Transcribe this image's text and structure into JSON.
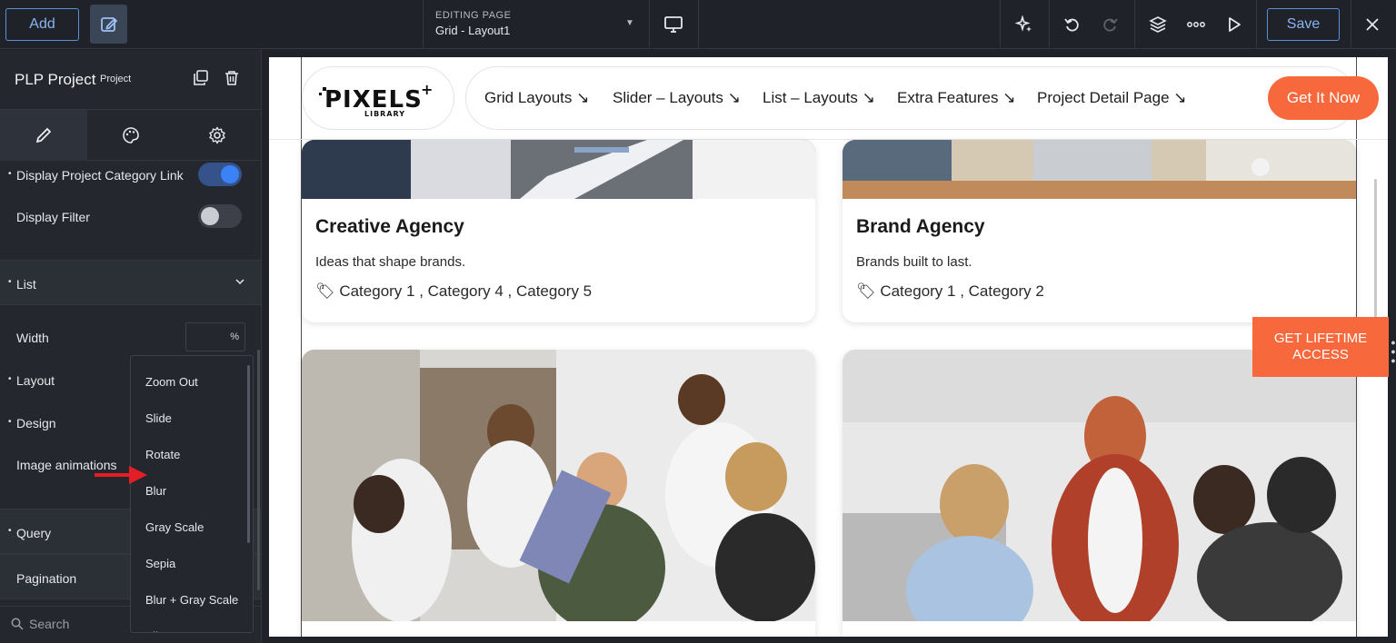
{
  "topbar": {
    "add_label": "Add",
    "editing_label": "EDITING PAGE",
    "editing_value": "Grid - Layout1",
    "save_label": "Save"
  },
  "panel": {
    "title": "PLP Project",
    "subtitle": "Project",
    "rows": {
      "display_category_link": "Display Project Category Link",
      "display_filter": "Display Filter",
      "width": "Width",
      "width_unit": "%",
      "layout": "Layout",
      "design": "Design",
      "image_animations": "Image animations"
    },
    "sections": {
      "list": "List",
      "query": "Query",
      "pagination": "Pagination"
    },
    "toggles": {
      "display_category_link": true,
      "display_filter": false
    },
    "search_placeholder": "Search"
  },
  "dropdown": {
    "options": [
      "Zoom Out",
      "Slide",
      "Rotate",
      "Blur",
      "Gray Scale",
      "Sepia",
      "Blur + Gray Scale",
      "Flip H..."
    ]
  },
  "site": {
    "logo_text": "PIXELS",
    "logo_sub": "LIBRARY",
    "nav": [
      "Grid Layouts ↘",
      "Slider – Layouts ↘",
      "List – Layouts ↘",
      "Extra Features ↘",
      "Project Detail Page ↘"
    ],
    "cta": "Get It Now",
    "cards": [
      {
        "title": "Creative Agency",
        "desc": "Ideas that shape brands.",
        "cats": "Category 1 , Category 4 , Category 5"
      },
      {
        "title": "Brand Agency",
        "desc": "Brands built to last.",
        "cats": "Category 1 , Category 2"
      }
    ],
    "lifetime_line1": "GET LIFETIME",
    "lifetime_line2": "ACCESS"
  },
  "colors": {
    "accent": "#f7693d",
    "toggle_on": "#3b82f6",
    "editor_bg": "#1f2229"
  }
}
